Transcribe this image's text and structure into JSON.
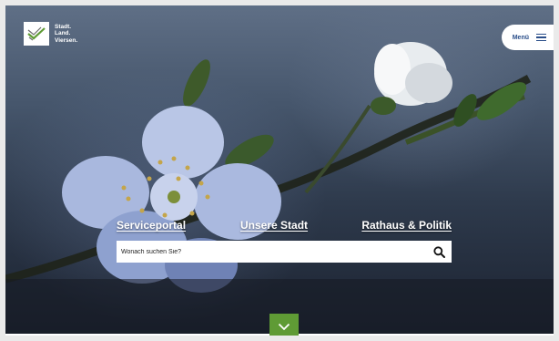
{
  "header": {
    "logo_lines": [
      "Stadt.",
      "Land.",
      "Viersen."
    ],
    "menu_label": "Menü"
  },
  "nav": {
    "items": [
      "Serviceportal",
      "Unsere Stadt",
      "Rathaus & Politik"
    ]
  },
  "search": {
    "placeholder": "Wonach suchen Sie?"
  },
  "icons": {
    "menu": "hamburger-icon",
    "search": "search-icon",
    "scroll": "chevron-down-icon",
    "logo": "checkmark-logo-icon"
  },
  "colors": {
    "accent_green": "#5f9b35",
    "menu_text": "#2b4f8a"
  }
}
